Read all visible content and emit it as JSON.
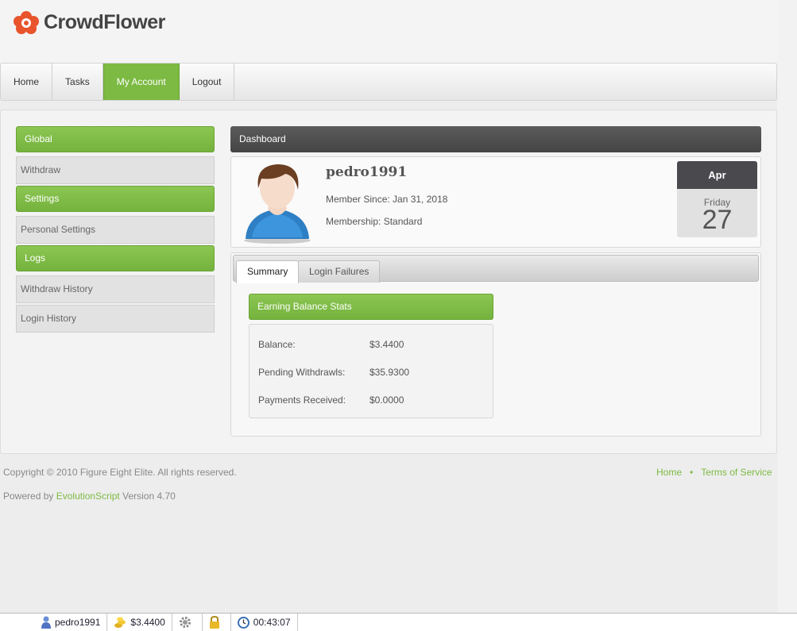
{
  "brand": {
    "name": "CrowdFlower",
    "accent": "#7cba43",
    "logo_color": "#e8542c"
  },
  "nav": {
    "items": [
      {
        "label": "Home",
        "active": false
      },
      {
        "label": "Tasks",
        "active": false
      },
      {
        "label": "My Account",
        "active": true
      },
      {
        "label": "Logout",
        "active": false
      }
    ]
  },
  "sidebar": {
    "sections": [
      {
        "heading": "Global",
        "links": [
          "Withdraw"
        ]
      },
      {
        "heading": "Settings",
        "links": [
          "Personal Settings"
        ]
      },
      {
        "heading": "Logs",
        "links": [
          "Withdraw History",
          "Login History"
        ]
      }
    ]
  },
  "dashboard": {
    "title": "Dashboard",
    "username": "pedro1991",
    "member_since": "Member Since: Jan 31, 2018",
    "membership": "Membership: Standard",
    "calendar": {
      "month": "Apr",
      "weekday": "Friday",
      "day": "27"
    }
  },
  "tabs": [
    {
      "label": "Summary",
      "active": true
    },
    {
      "label": "Login Failures",
      "active": false
    }
  ],
  "earnings": {
    "title": "Earning Balance Stats",
    "rows": [
      {
        "label": "Balance:",
        "value": "$3.4400"
      },
      {
        "label": "Pending Withdrawls:",
        "value": "$35.9300"
      },
      {
        "label": "Payments Received:",
        "value": "$0.0000"
      }
    ]
  },
  "footer": {
    "copyright": "Copyright © 2010 Figure Eight Elite. All rights reserved.",
    "powered_prefix": "Powered by",
    "powered_link": "EvolutionScript",
    "powered_suffix": "Version 4.70",
    "links": [
      "Home",
      "Terms of Service"
    ],
    "separator": "•"
  },
  "statusbar": {
    "username": "pedro1991",
    "balance": "$3.4400",
    "timer": "00:43:07",
    "icons": [
      "user-icon",
      "coins-icon",
      "gear-icon",
      "lock-icon",
      "clock-icon"
    ]
  }
}
